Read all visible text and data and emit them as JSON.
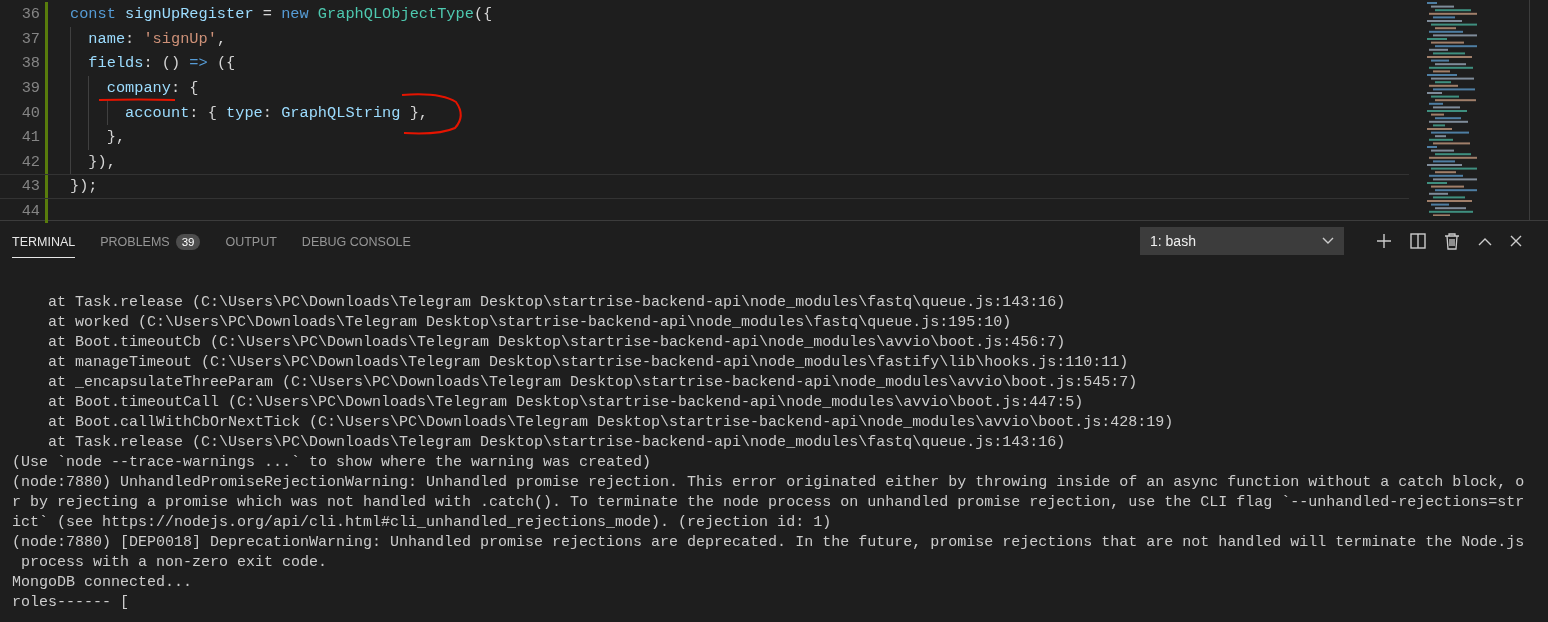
{
  "editor": {
    "lines": [
      {
        "number": "36",
        "modified": true,
        "tokens": [
          {
            "kind": "keyword",
            "text": "const "
          },
          {
            "kind": "variable",
            "text": "signUpRegister"
          },
          {
            "kind": "plain",
            "text": " = "
          },
          {
            "kind": "keyword",
            "text": "new "
          },
          {
            "kind": "class",
            "text": "GraphQLObjectType"
          },
          {
            "kind": "plain",
            "text": "({"
          }
        ]
      },
      {
        "number": "37",
        "modified": true,
        "tokens": [
          {
            "kind": "property",
            "text": "  name"
          },
          {
            "kind": "plain",
            "text": ": "
          },
          {
            "kind": "string",
            "text": "'signUp'"
          },
          {
            "kind": "plain",
            "text": ","
          }
        ]
      },
      {
        "number": "38",
        "modified": true,
        "tokens": [
          {
            "kind": "property",
            "text": "  fields"
          },
          {
            "kind": "plain",
            "text": ": () "
          },
          {
            "kind": "keyword",
            "text": "=>"
          },
          {
            "kind": "plain",
            "text": " ({"
          }
        ]
      },
      {
        "number": "39",
        "modified": true,
        "tokens": [
          {
            "kind": "property",
            "text": "    company"
          },
          {
            "kind": "plain",
            "text": ": {"
          }
        ]
      },
      {
        "number": "40",
        "modified": true,
        "tokens": [
          {
            "kind": "property",
            "text": "      account"
          },
          {
            "kind": "plain",
            "text": ": { "
          },
          {
            "kind": "property",
            "text": "type"
          },
          {
            "kind": "plain",
            "text": ": "
          },
          {
            "kind": "variable",
            "text": "GraphQLString"
          },
          {
            "kind": "plain",
            "text": " },"
          }
        ]
      },
      {
        "number": "41",
        "modified": true,
        "tokens": [
          {
            "kind": "plain",
            "text": "    },"
          }
        ]
      },
      {
        "number": "42",
        "modified": true,
        "tokens": [
          {
            "kind": "plain",
            "text": "  }),"
          }
        ]
      },
      {
        "number": "43",
        "modified": true,
        "tokens": [
          {
            "kind": "plain",
            "text": "});"
          }
        ]
      },
      {
        "number": "44",
        "modified": true
      }
    ]
  },
  "panel": {
    "tabs": [
      {
        "label": "TERMINAL",
        "selected": true
      },
      {
        "label": "PROBLEMS",
        "selected": false,
        "badge": "39"
      },
      {
        "label": "OUTPUT",
        "selected": false
      },
      {
        "label": "DEBUG CONSOLE",
        "selected": false
      }
    ],
    "terminal_select": {
      "value": "1: bash"
    },
    "terminal": {
      "lines": [
        {
          "kind": "plain",
          "text": "    at Task.release (C:\\Users\\PC\\Downloads\\Telegram Desktop\\startrise-backend-api\\node_modules\\fastq\\queue.js:143:16)"
        },
        {
          "kind": "plain",
          "text": "    at worked (C:\\Users\\PC\\Downloads\\Telegram Desktop\\startrise-backend-api\\node_modules\\fastq\\queue.js:195:10)"
        },
        {
          "kind": "plain",
          "text": "    at Boot.timeoutCb (C:\\Users\\PC\\Downloads\\Telegram Desktop\\startrise-backend-api\\node_modules\\avvio\\boot.js:456:7)"
        },
        {
          "kind": "plain",
          "text": "    at manageTimeout (C:\\Users\\PC\\Downloads\\Telegram Desktop\\startrise-backend-api\\node_modules\\fastify\\lib\\hooks.js:110:11)"
        },
        {
          "kind": "plain",
          "text": "    at _encapsulateThreeParam (C:\\Users\\PC\\Downloads\\Telegram Desktop\\startrise-backend-api\\node_modules\\avvio\\boot.js:545:7)"
        },
        {
          "kind": "plain",
          "text": "    at Boot.timeoutCall (C:\\Users\\PC\\Downloads\\Telegram Desktop\\startrise-backend-api\\node_modules\\avvio\\boot.js:447:5)"
        },
        {
          "kind": "plain",
          "text": "    at Boot.callWithCbOrNextTick (C:\\Users\\PC\\Downloads\\Telegram Desktop\\startrise-backend-api\\node_modules\\avvio\\boot.js:428:19)"
        },
        {
          "kind": "plain",
          "text": "    at Task.release (C:\\Users\\PC\\Downloads\\Telegram Desktop\\startrise-backend-api\\node_modules\\fastq\\queue.js:143:16)"
        },
        {
          "kind": "plain",
          "text": "(Use `node --trace-warnings ...` to show where the warning was created)"
        },
        {
          "kind": "plain",
          "text": "(node:7880) UnhandledPromiseRejectionWarning: Unhandled promise rejection. This error originated either by throwing inside of an async function without a catch block, o"
        },
        {
          "kind": "plain",
          "text": "r by rejecting a promise which was not handled with .catch(). To terminate the node process on unhandled promise rejection, use the CLI flag `--unhandled-rejections=str"
        },
        {
          "kind": "plain",
          "text": "ict` (see https://nodejs.org/api/cli.html#cli_unhandled_rejections_mode). (rejection id: 1)"
        },
        {
          "kind": "plain",
          "text": "(node:7880) [DEP0018] DeprecationWarning: Unhandled promise rejections are deprecated. In the future, promise rejections that are not handled will terminate the Node.js"
        },
        {
          "kind": "plain",
          "text": " process with a non-zero exit code."
        },
        {
          "kind": "plain",
          "text": "MongoDB connected..."
        },
        {
          "kind": "plain",
          "text": "roles------ ["
        }
      ]
    }
  }
}
